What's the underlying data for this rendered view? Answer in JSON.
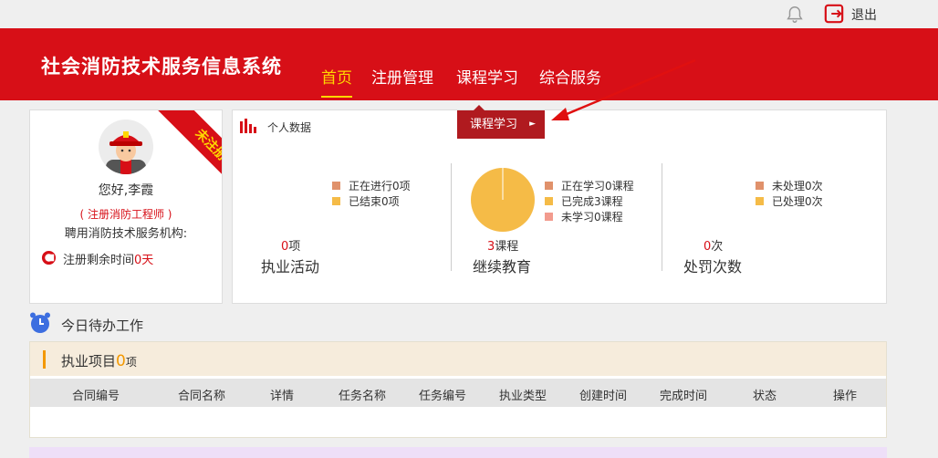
{
  "topbar": {
    "logout_label": "退出"
  },
  "header": {
    "title": "社会消防技术服务信息系统",
    "nav": [
      {
        "label": "首页",
        "active": true
      },
      {
        "label": "注册管理",
        "active": false
      },
      {
        "label": "课程学习",
        "active": false
      },
      {
        "label": "综合服务",
        "active": false
      }
    ]
  },
  "profile": {
    "ribbon": "未注册",
    "greeting": "您好,李霞",
    "role": "( 注册消防工程师 )",
    "org_label": "聘用消防技术服务机构:",
    "remaining_label": "注册剩余时间",
    "remaining_value": "0",
    "remaining_unit": "天"
  },
  "stats": {
    "header": "个人数据",
    "dropdown_tab": "课程学习",
    "practice": {
      "legend": [
        "正在进行0项",
        "已结束0项"
      ],
      "count": "0",
      "count_unit": "项",
      "label": "执业活动"
    },
    "education": {
      "legend": [
        "正在学习0课程",
        "已完成3课程",
        "未学习0课程"
      ],
      "count": "3",
      "count_unit": "课程",
      "label": "继续教育"
    },
    "penalty": {
      "legend": [
        "未处理0次",
        "已处理0次"
      ],
      "count": "0",
      "count_unit": "次",
      "label": "处罚次数"
    }
  },
  "colors": {
    "brand_red": "#d70f17",
    "legend_orange": "#e0916b",
    "legend_yellow": "#f5bb47",
    "legend_pink": "#f29b8e",
    "accent_orange": "#f39800"
  },
  "todo": {
    "title": "今日待办工作",
    "project": {
      "title": "执业项目",
      "count": "0",
      "unit": "项",
      "columns": [
        "合同编号",
        "合同名称",
        "详情",
        "任务名称",
        "任务编号",
        "执业类型",
        "创建时间",
        "完成时间",
        "状态",
        "操作"
      ]
    }
  }
}
